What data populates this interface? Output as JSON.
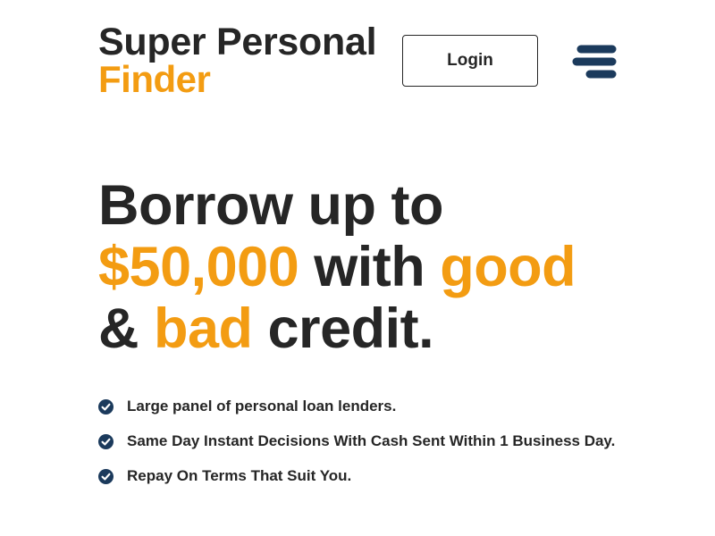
{
  "brand": {
    "name_line1": "Super Personal",
    "name_line2": "Finder"
  },
  "header": {
    "login_label": "Login",
    "menu_icon": "hamburger-menu-icon"
  },
  "hero": {
    "line1": "Borrow up to",
    "amount": "$50,000",
    "with": " with ",
    "good": "good",
    "amp": "& ",
    "bad": "bad",
    "credit": " credit."
  },
  "features": [
    {
      "icon": "check-circle-icon",
      "text": "Large panel of personal loan lenders."
    },
    {
      "icon": "check-circle-icon",
      "text": "Same Day Instant Decisions With Cash Sent Within 1 Business Day."
    },
    {
      "icon": "check-circle-icon",
      "text": "Repay On Terms That Suit You."
    }
  ],
  "colors": {
    "accent": "#f39c12",
    "text": "#262626",
    "navy": "#1b3a5c"
  }
}
